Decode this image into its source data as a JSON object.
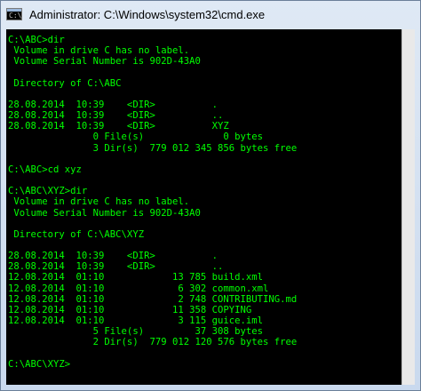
{
  "window": {
    "title": "Administrator: C:\\Windows\\system32\\cmd.exe",
    "icon": "cmd-icon"
  },
  "console": {
    "text_color": "#00ff00",
    "background": "#000000",
    "lines": [
      "C:\\ABC>dir",
      " Volume in drive C has no label.",
      " Volume Serial Number is 902D-43A0",
      "",
      " Directory of C:\\ABC",
      "",
      "28.08.2014  10:39    <DIR>          .",
      "28.08.2014  10:39    <DIR>          ..",
      "28.08.2014  10:39    <DIR>          XYZ",
      "               0 File(s)              0 bytes",
      "               3 Dir(s)  779 012 345 856 bytes free",
      "",
      "C:\\ABC>cd xyz",
      "",
      "C:\\ABC\\XYZ>dir",
      " Volume in drive C has no label.",
      " Volume Serial Number is 902D-43A0",
      "",
      " Directory of C:\\ABC\\XYZ",
      "",
      "28.08.2014  10:39    <DIR>          .",
      "28.08.2014  10:39    <DIR>          ..",
      "12.08.2014  01:10            13 785 build.xml",
      "12.08.2014  01:10             6 302 common.xml",
      "12.08.2014  01:10             2 748 CONTRIBUTING.md",
      "12.08.2014  01:10            11 358 COPYING",
      "12.08.2014  01:10             3 115 guice.iml",
      "               5 File(s)         37 308 bytes",
      "               2 Dir(s)  779 012 120 576 bytes free",
      "",
      "C:\\ABC\\XYZ>"
    ]
  }
}
